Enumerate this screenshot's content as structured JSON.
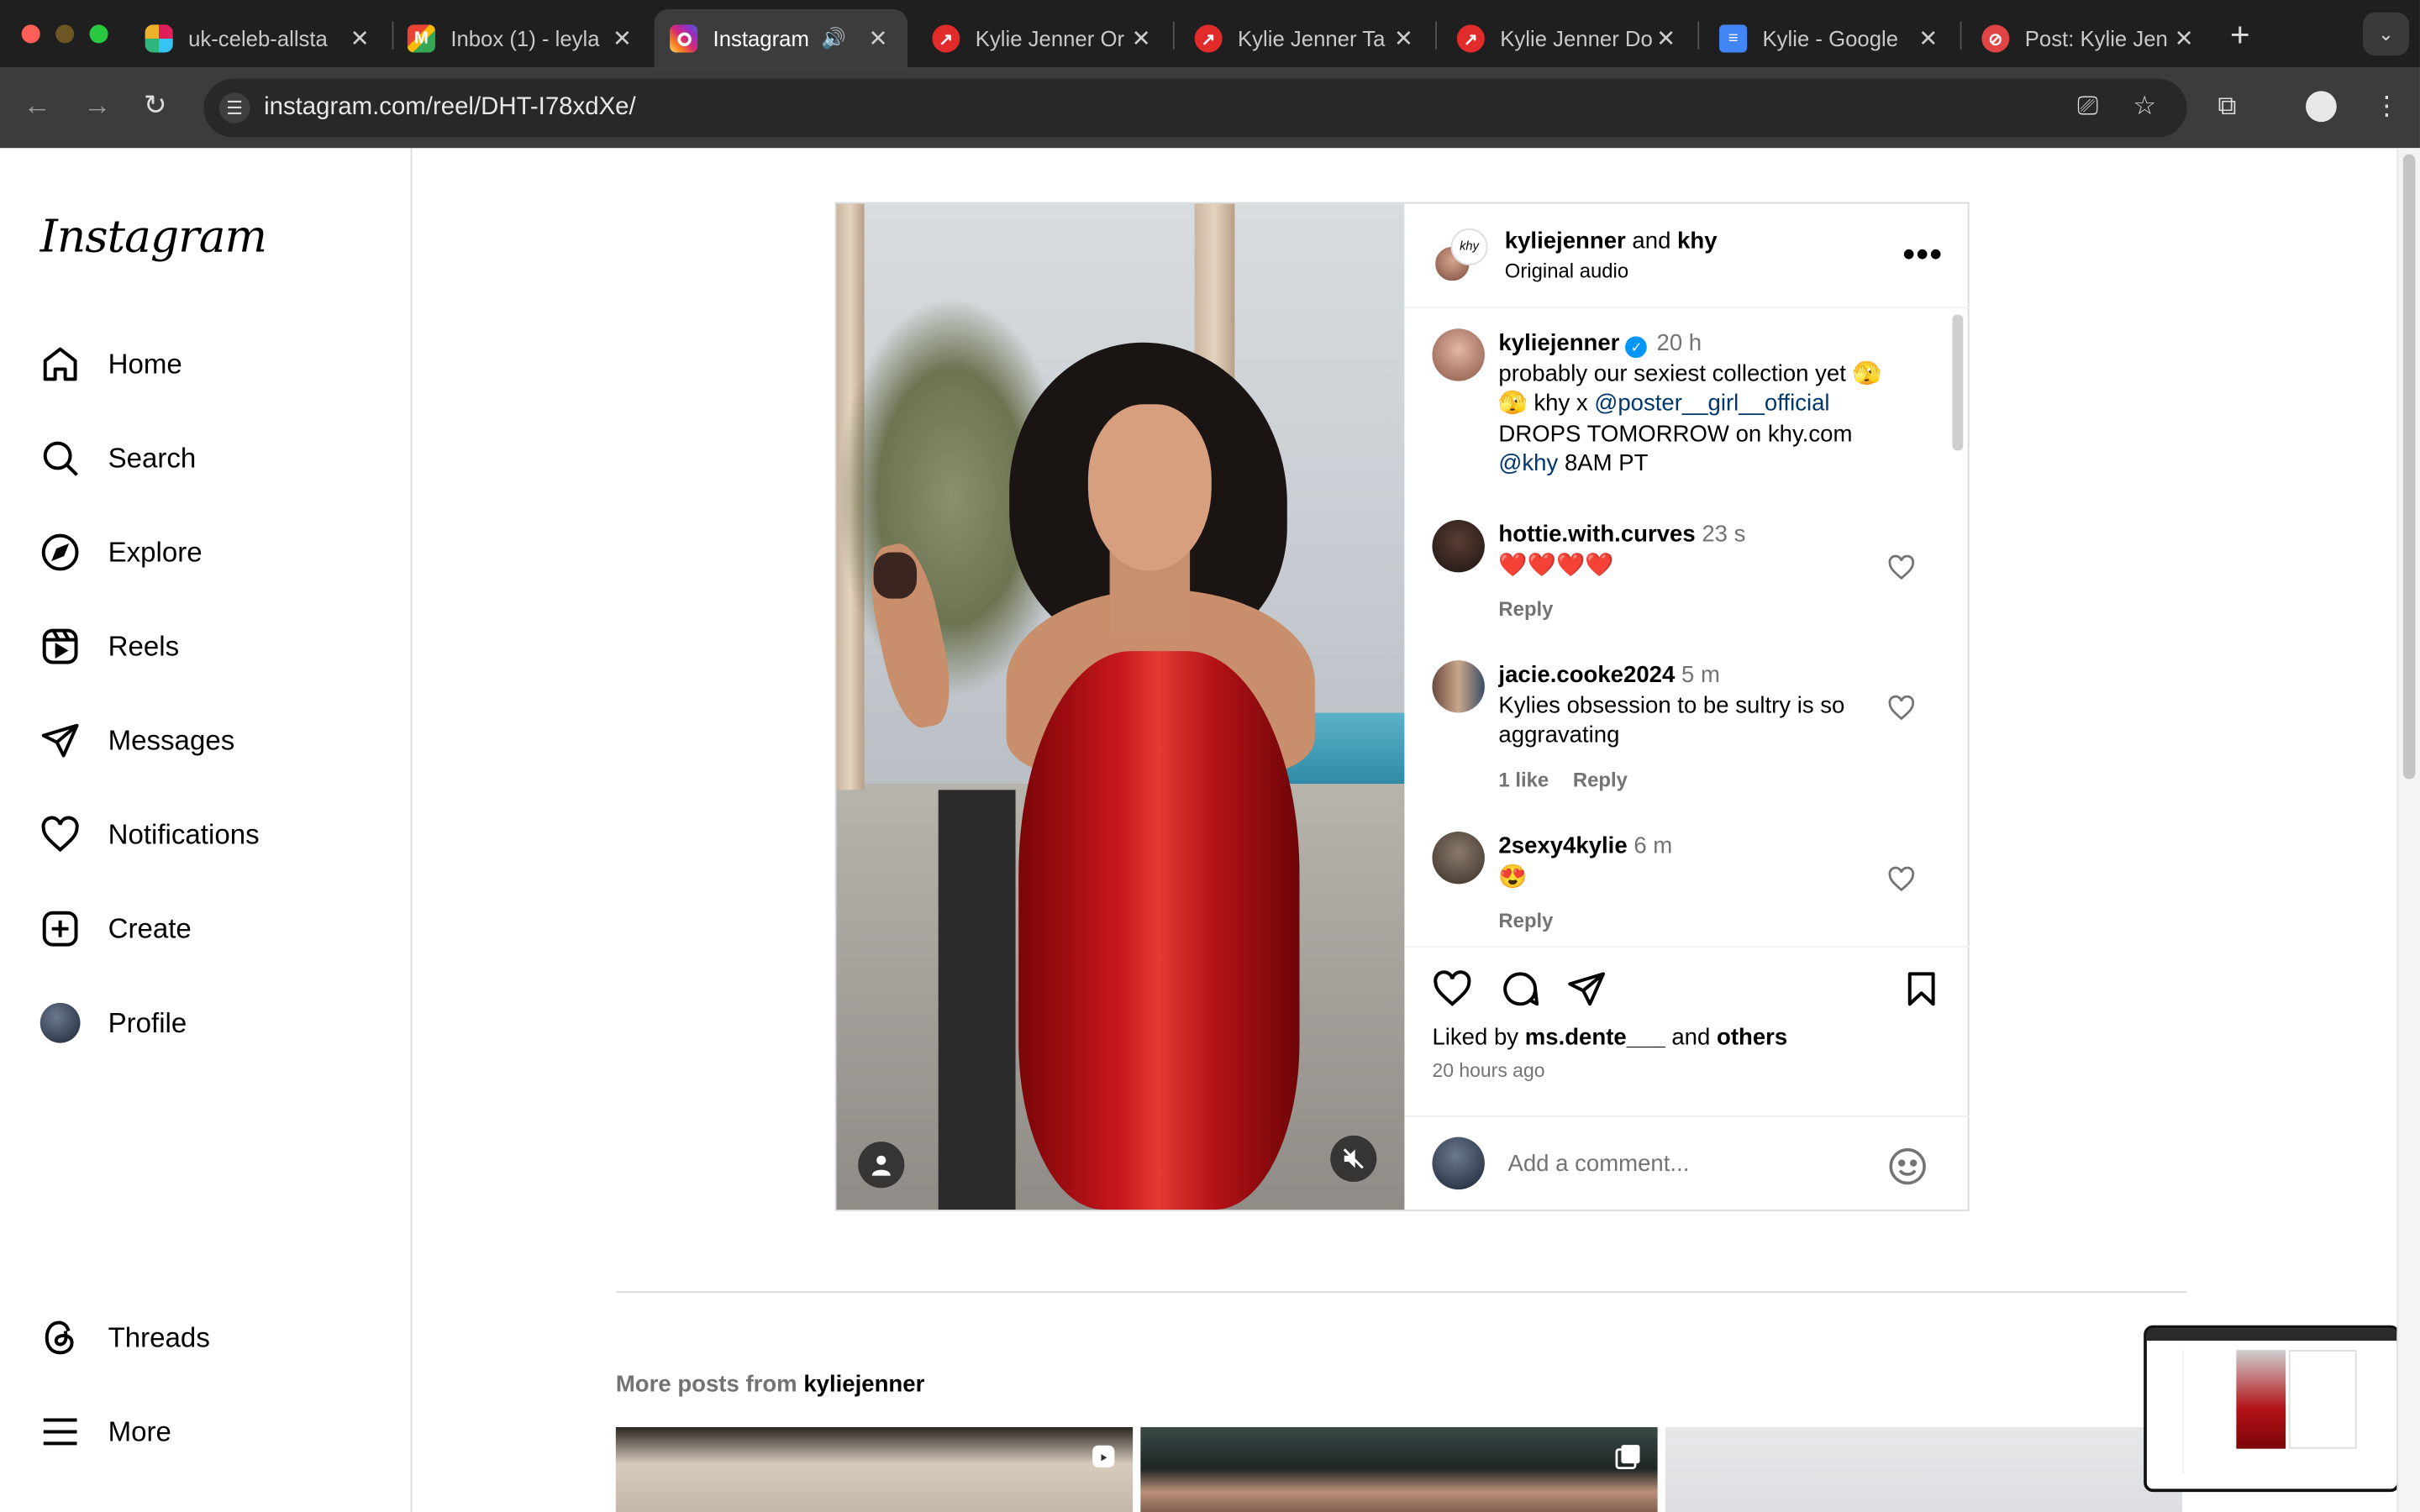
{
  "browser": {
    "tabs": [
      {
        "label": "uk-celeb-allsta",
        "favicon": "slack-icon"
      },
      {
        "label": "Inbox (1) - leyla",
        "favicon": "gmail-icon"
      },
      {
        "label": "Instagram",
        "favicon": "instagram-icon",
        "active": true
      },
      {
        "label": "Kylie Jenner Or",
        "favicon": "trend-icon"
      },
      {
        "label": "Kylie Jenner Ta",
        "favicon": "trend-icon"
      },
      {
        "label": "Kylie Jenner Do",
        "favicon": "trend-icon"
      },
      {
        "label": "Kylie - Google",
        "favicon": "google-docs-icon"
      },
      {
        "label": "Post: Kylie Jen",
        "favicon": "post-icon"
      }
    ],
    "url": "instagram.com/reel/DHT-I78xdXe/"
  },
  "sidebar": {
    "logo": "Instagram",
    "items": [
      {
        "label": "Home",
        "icon": "home-icon"
      },
      {
        "label": "Search",
        "icon": "search-icon"
      },
      {
        "label": "Explore",
        "icon": "compass-icon"
      },
      {
        "label": "Reels",
        "icon": "reels-icon"
      },
      {
        "label": "Messages",
        "icon": "send-icon"
      },
      {
        "label": "Notifications",
        "icon": "heart-icon"
      },
      {
        "label": "Create",
        "icon": "plus-square-icon"
      },
      {
        "label": "Profile",
        "icon": "avatar"
      }
    ],
    "bottom": [
      {
        "label": "Threads",
        "icon": "threads-icon"
      },
      {
        "label": "More",
        "icon": "menu-icon"
      }
    ]
  },
  "post": {
    "header": {
      "user": "kyliejenner",
      "and": "and",
      "collab": "khy",
      "audio": "Original audio"
    },
    "caption": {
      "user": "kyliejenner",
      "time": "20 h",
      "line1": "probably our sexiest collection yet 🫣",
      "line2_pre": "🫣 khy x ",
      "line2_mention": "@poster__girl__official",
      "line3": "DROPS TOMORROW on khy.com",
      "line4_mention": "@khy",
      "line4_post": " 8AM PT"
    },
    "comments": [
      {
        "user": "hottie.with.curves",
        "time": "23 s",
        "text": "❤️❤️❤️❤️",
        "reply": "Reply"
      },
      {
        "user": "jacie.cooke2024",
        "time": "5 m",
        "text": "Kylies obsession to be sultry is so aggravating",
        "likes": "1 like",
        "reply": "Reply"
      },
      {
        "user": "2sexy4kylie",
        "time": "6 m",
        "text": "😍",
        "reply": "Reply"
      }
    ],
    "liked_by_prefix": "Liked by",
    "liked_by_user": "ms.dente___",
    "liked_by_and": "and",
    "liked_by_others": "others",
    "posted_ago": "20 hours ago",
    "comment_placeholder": "Add a comment..."
  },
  "more_posts": {
    "prefix": "More posts from",
    "user": "kyliejenner"
  },
  "colors": {
    "accent": "#0095f6",
    "mention": "#00376b",
    "muted": "#737373",
    "chrome_dark": "#1f1f1f"
  }
}
